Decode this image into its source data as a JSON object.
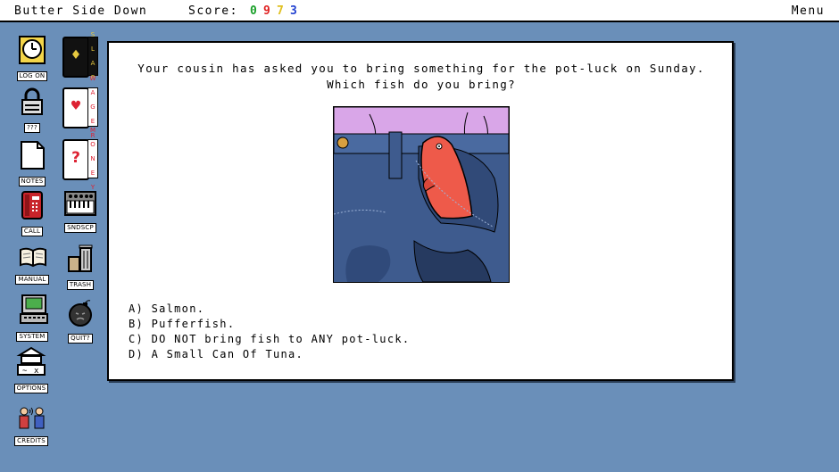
{
  "header": {
    "title": "Butter Side Down",
    "score_label": "Score:",
    "score_digits": [
      {
        "value": "0",
        "color": "#1aa02a"
      },
      {
        "value": "9",
        "color": "#e02020"
      },
      {
        "value": "7",
        "color": "#e0c020"
      },
      {
        "value": "3",
        "color": "#2040d0"
      }
    ],
    "menu_label": "Menu"
  },
  "desktop": {
    "log_on": "LOG ON",
    "lock": "???",
    "notes": "NOTES",
    "call": "CALL",
    "manual": "MANUAL",
    "system": "SYSTEM",
    "options": "OPTIONS",
    "credits": "CREDITS",
    "slap": "SLAP",
    "wager": "WAGER",
    "money": "MONEY",
    "sndscp": "SNDSCP",
    "trash": "TRASH",
    "quit": "QUIT?"
  },
  "dialog": {
    "question": "Your cousin has asked you to bring something for the pot-luck on Sunday. Which fish do you bring?",
    "answers": [
      "A) Salmon.",
      "B) Pufferfish.",
      "C) DO NOT bring fish to ANY pot-luck.",
      "D) A Small Can Of Tuna."
    ]
  },
  "colors": {
    "desktop_bg": "#6a8fb9",
    "shirt": "#d9a6e8",
    "jeans": "#3e5b8e",
    "fish": "#ee5a4a"
  }
}
